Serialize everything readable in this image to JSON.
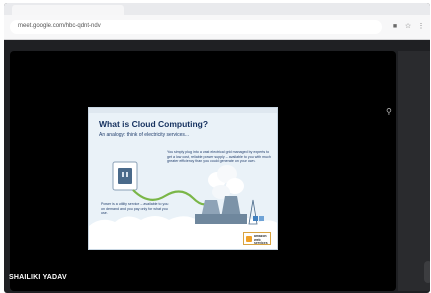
{
  "browser": {
    "url": "meet.google.com/hbc-qdnt-ndv"
  },
  "toolbar_icons": [
    "camera-icon",
    "bookmark-icon",
    "menu-icon"
  ],
  "slide": {
    "title": "What is Cloud Computing?",
    "subtitle": "An analogy: think of electricity services...",
    "paragraph1": "You simply plug into a vast electrical grid managed by experts to get a low cost, reliable power supply – available to you with much greater efficiency than you could generate on your own.",
    "paragraph2": "Power is a utility service – available to you on demand and you pay only for what you use.",
    "logo_text": "amazon web services"
  },
  "participant": {
    "name": "SHAILIKI YADAV"
  },
  "colors": {
    "stage": "#000000",
    "chrome_dark": "#1f2023",
    "slide_title": "#15315f"
  }
}
